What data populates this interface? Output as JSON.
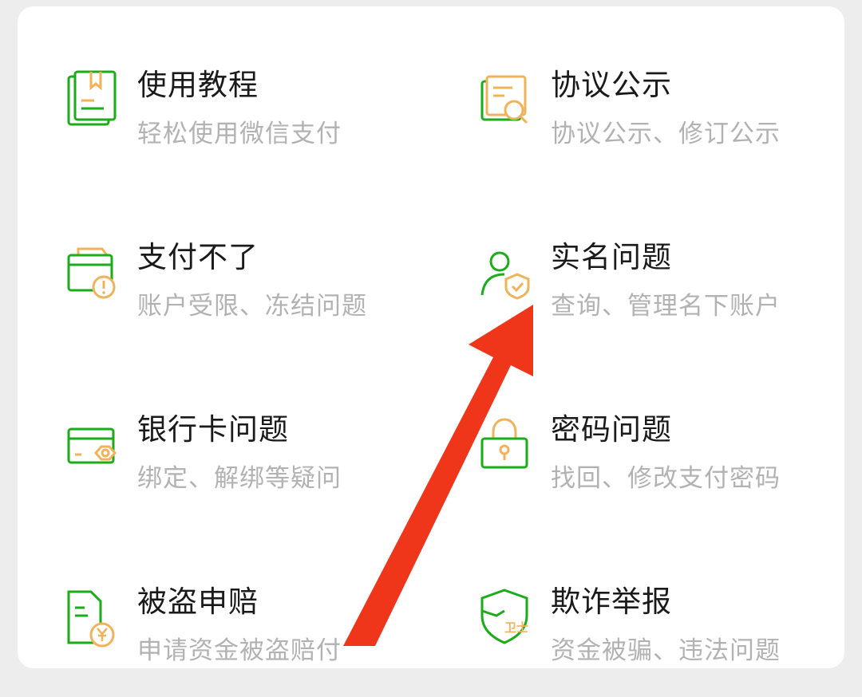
{
  "colors": {
    "green": "#1aad19",
    "orange": "#f0b35a",
    "arrow": "#f0361a"
  },
  "items": [
    {
      "title": "使用教程",
      "subtitle": "轻松使用微信支付",
      "icon": "book-icon"
    },
    {
      "title": "协议公示",
      "subtitle": "协议公示、修订公示",
      "icon": "document-search-icon"
    },
    {
      "title": "支付不了",
      "subtitle": "账户受限、冻结问题",
      "icon": "wallet-alert-icon"
    },
    {
      "title": "实名问题",
      "subtitle": "查询、管理名下账户",
      "icon": "user-shield-icon"
    },
    {
      "title": "银行卡问题",
      "subtitle": "绑定、解绑等疑问",
      "icon": "bank-card-icon"
    },
    {
      "title": "密码问题",
      "subtitle": "找回、修改支付密码",
      "icon": "lock-icon"
    },
    {
      "title": "被盗申赔",
      "subtitle": "申请资金被盗赔付",
      "icon": "claim-document-icon"
    },
    {
      "title": "欺诈举报",
      "subtitle": "资金被骗、违法问题",
      "icon": "guard-shield-icon"
    }
  ]
}
